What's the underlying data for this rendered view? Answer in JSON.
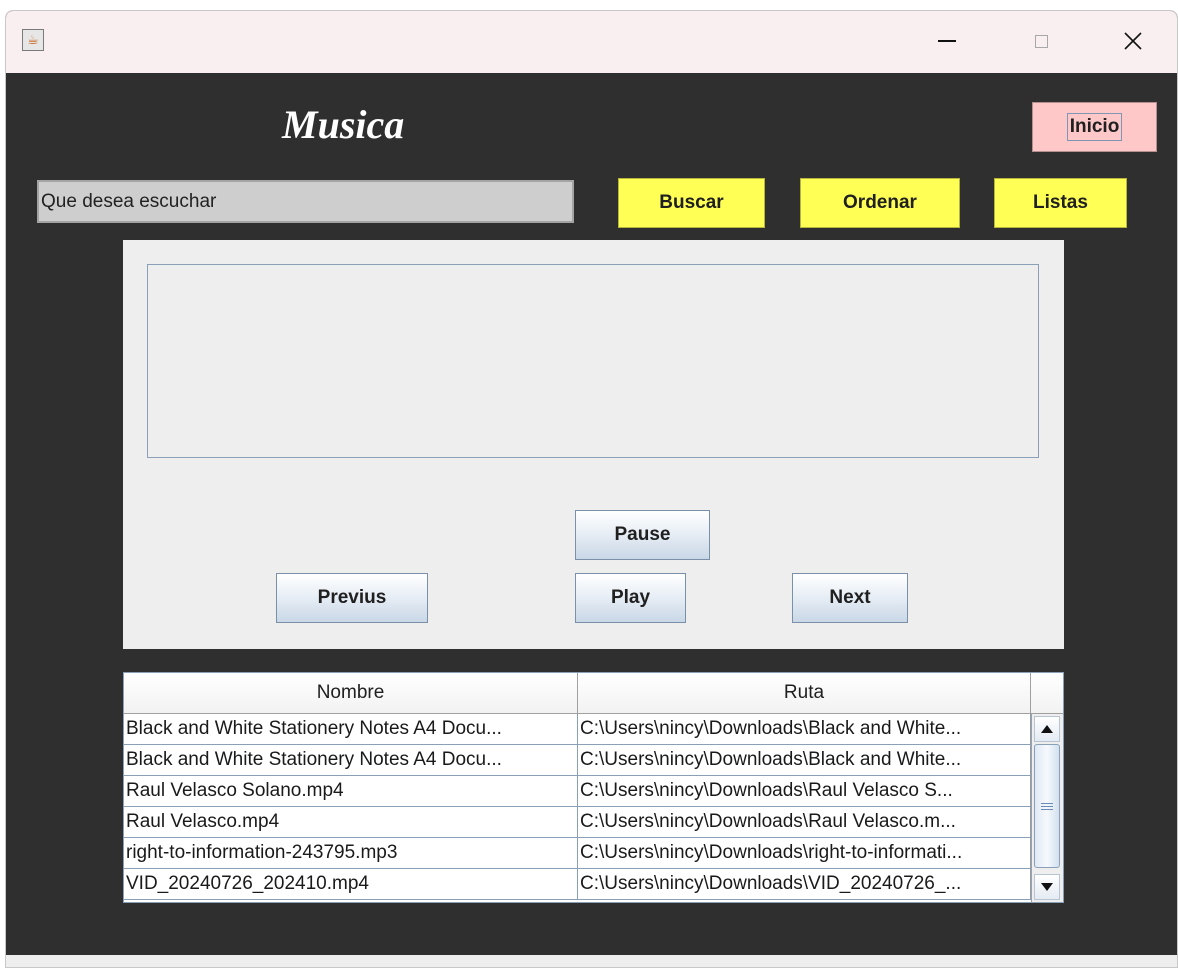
{
  "window": {
    "app_icon": "java-cup-icon",
    "controls": {
      "minimize_icon": "minimize-icon",
      "maximize_icon": "maximize-icon",
      "close_icon": "close-icon"
    }
  },
  "header": {
    "title": "Musica",
    "inicio_label": "Inicio"
  },
  "search": {
    "value": "Que desea escuchar"
  },
  "toolbar": {
    "buscar_label": "Buscar",
    "ordenar_label": "Ordenar",
    "listas_label": "Listas"
  },
  "player": {
    "pause_label": "Pause",
    "previus_label": "Previus",
    "play_label": "Play",
    "next_label": "Next"
  },
  "table": {
    "columns": [
      "Nombre",
      "Ruta"
    ],
    "rows": [
      {
        "nombre": "Black and White Stationery Notes A4 Docu...",
        "ruta": "C:\\Users\\nincy\\Downloads\\Black and White..."
      },
      {
        "nombre": "Black and White Stationery Notes A4 Docu...",
        "ruta": "C:\\Users\\nincy\\Downloads\\Black and White..."
      },
      {
        "nombre": "Raul Velasco Solano.mp4",
        "ruta": "C:\\Users\\nincy\\Downloads\\Raul Velasco S..."
      },
      {
        "nombre": "Raul Velasco.mp4",
        "ruta": "C:\\Users\\nincy\\Downloads\\Raul Velasco.m..."
      },
      {
        "nombre": "right-to-information-243795.mp3",
        "ruta": "C:\\Users\\nincy\\Downloads\\right-to-informati..."
      },
      {
        "nombre": "VID_20240726_202410.mp4",
        "ruta": "C:\\Users\\nincy\\Downloads\\VID_20240726_..."
      }
    ]
  },
  "colors": {
    "background": "#2f2f2f",
    "title_bar": "#f9eef0",
    "yellow_button": "#ffff55",
    "pink_button": "#ffc8c8",
    "panel": "#eeeeee"
  }
}
